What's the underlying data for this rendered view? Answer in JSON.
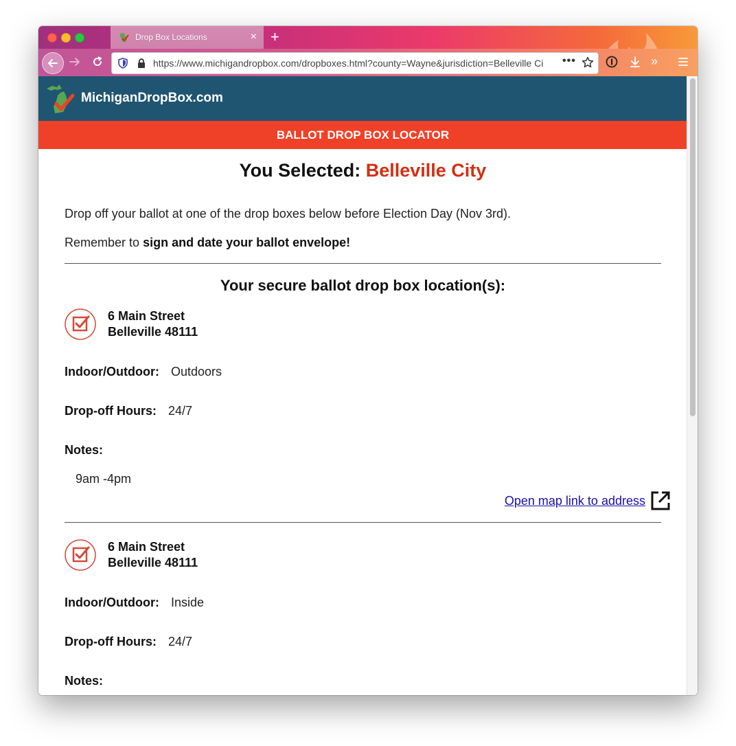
{
  "browser": {
    "tab_title": "Drop Box Locations",
    "tab_close": "×",
    "new_tab": "+",
    "url": "https://www.michigandropbox.com/dropboxes.html?county=Wayne&jurisdiction=Belleville Ci",
    "url_more": "•••",
    "overflow": "»"
  },
  "site": {
    "name": "MichiganDropBox.com",
    "banner": "BALLOT DROP BOX LOCATOR"
  },
  "selection": {
    "prefix": "You Selected:",
    "place": "Belleville City"
  },
  "intro": "Drop off your ballot at one of the drop boxes below before Election Day (Nov 3rd).",
  "reminder": {
    "prefix": "Remember to",
    "emphasis": "sign and date your ballot envelope!"
  },
  "locations_title": "Your secure ballot drop box location(s):",
  "labels": {
    "indoor_outdoor": "Indoor/Outdoor:",
    "hours": "Drop-off Hours:",
    "notes": "Notes:",
    "map_link": "Open map link to address"
  },
  "locations": [
    {
      "street": "6 Main Street",
      "city": "Belleville 48111",
      "indoor_outdoor": "Outdoors",
      "hours": "24/7",
      "notes": "9am -4pm"
    },
    {
      "street": "6 Main Street",
      "city": "Belleville 48111",
      "indoor_outdoor": "Inside",
      "hours": "24/7",
      "notes": ""
    }
  ],
  "colors": {
    "header_bg": "#1f5571",
    "banner_bg": "#ef4128",
    "accent_red": "#d22f14",
    "link": "#1a0dab"
  }
}
